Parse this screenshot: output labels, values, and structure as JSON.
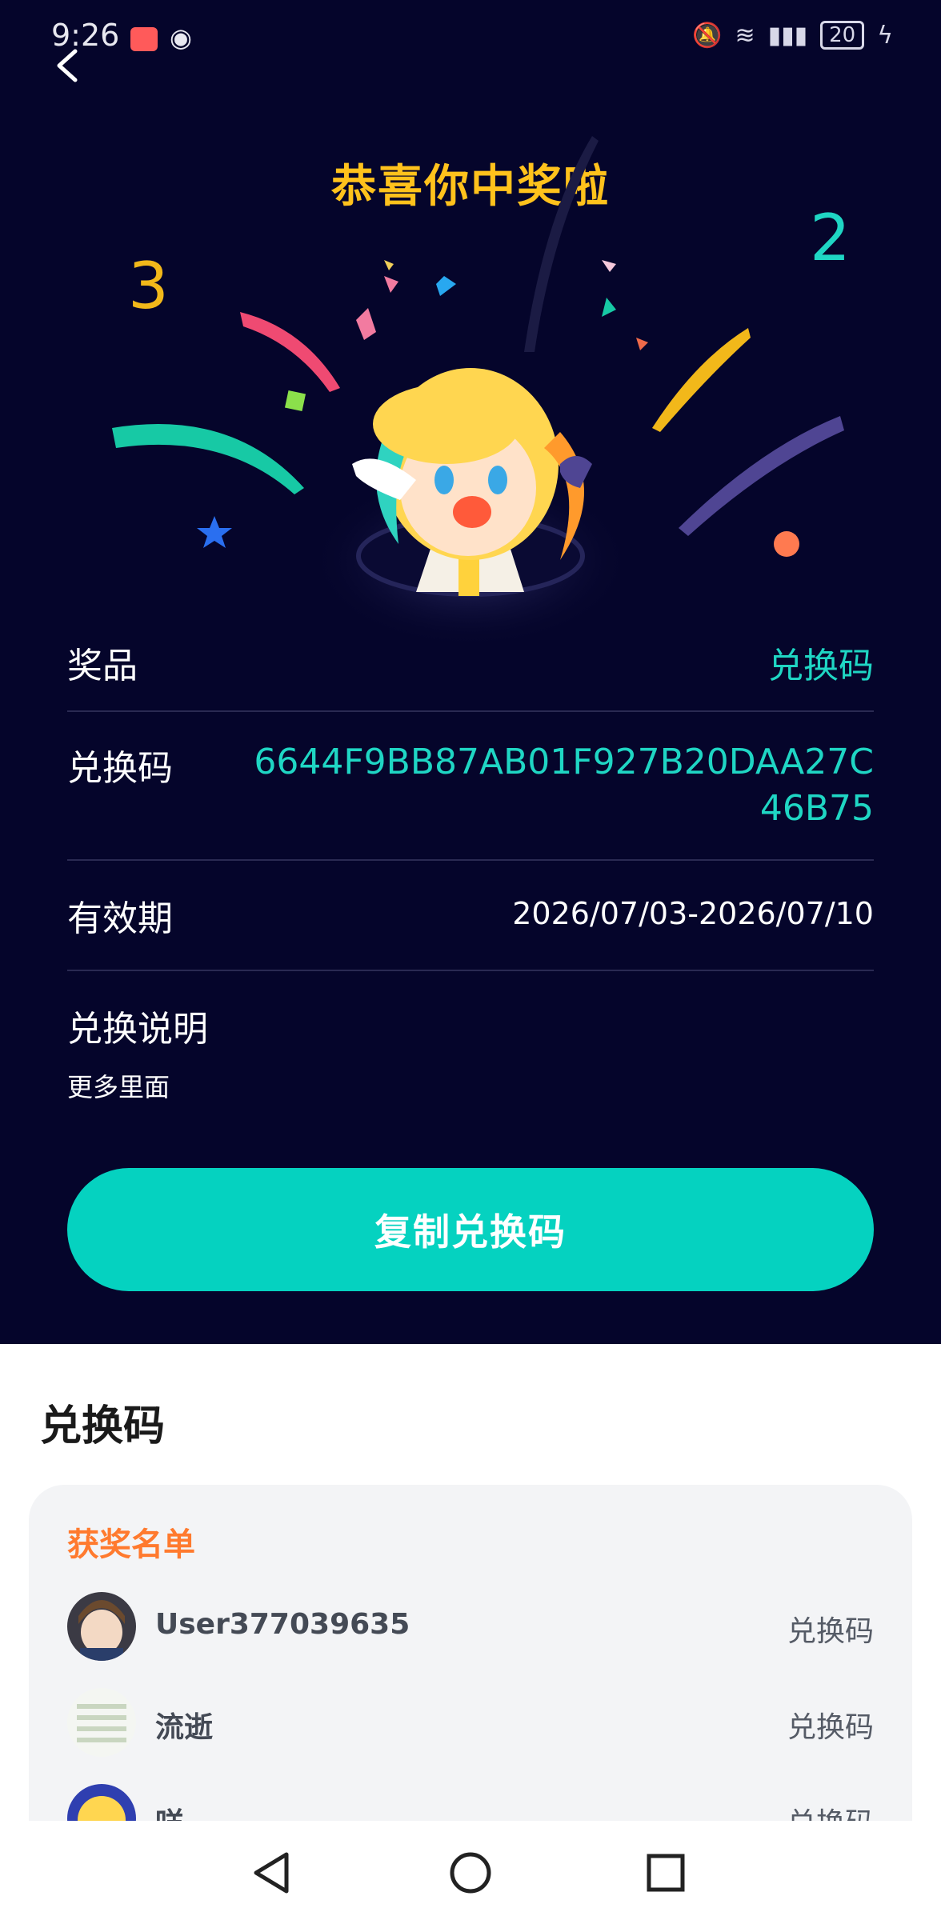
{
  "status_bar": {
    "time": "9:26",
    "battery": "20"
  },
  "header": {
    "title": "恭喜你中奖啦"
  },
  "prize": {
    "prize_label": "奖品",
    "prize_value": "兑换码",
    "code_label": "兑换码",
    "code_value": "6644F9BB87AB01F927B20DAA27C46B75",
    "validity_label": "有效期",
    "validity_value": "2026/07/03-2026/07/10",
    "desc_label": "兑换说明",
    "desc_value": "更多里面"
  },
  "actions": {
    "copy_label": "复制兑换码"
  },
  "section": {
    "title": "兑换码"
  },
  "winners": {
    "title": "获奖名单",
    "items": [
      {
        "name": "User377039635",
        "prize": "兑换码"
      },
      {
        "name": "流逝",
        "prize": "兑换码"
      },
      {
        "name": "咩",
        "prize": "兑换码"
      }
    ]
  },
  "colors": {
    "background_dark": "#05052b",
    "accent_teal": "#05d2c0",
    "title_yellow": "#ffc21c",
    "winners_orange": "#ff7a2e"
  },
  "icons": {
    "back": "back-arrow-icon",
    "nav_back": "triangle-back-icon",
    "nav_home": "circle-home-icon",
    "nav_recent": "square-recent-icon"
  }
}
